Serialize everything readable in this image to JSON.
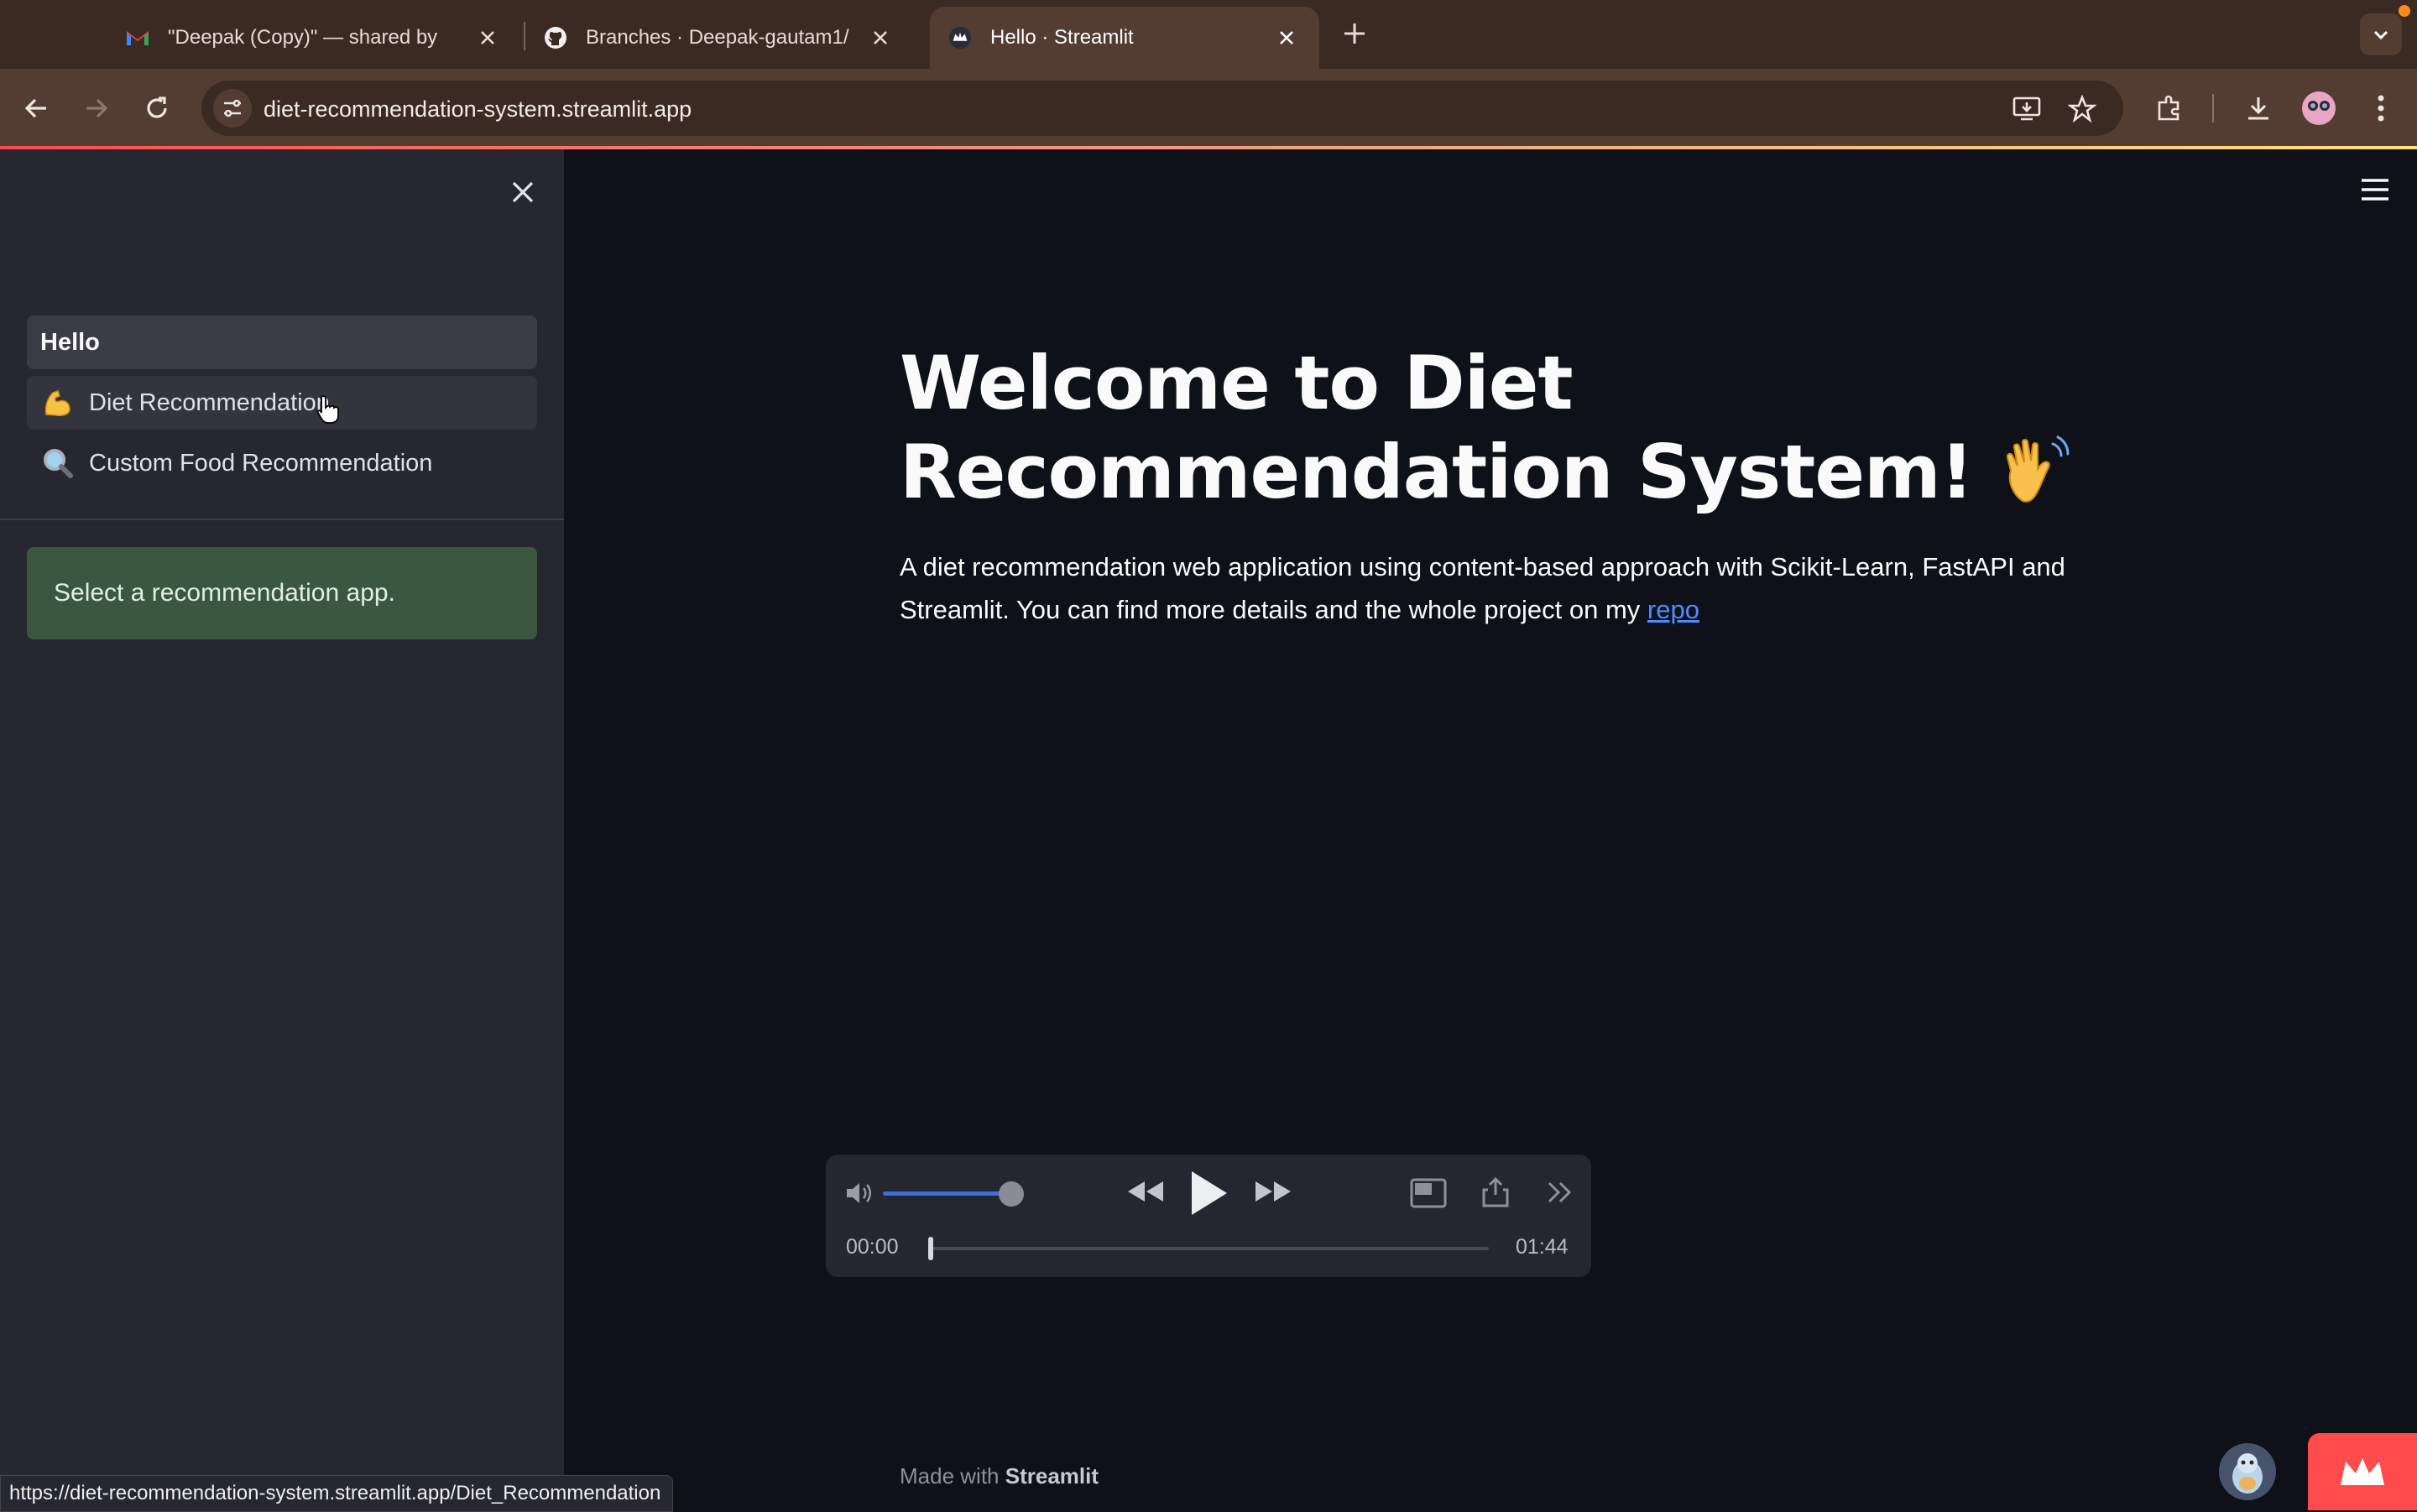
{
  "browser": {
    "tabs": [
      {
        "title": "\"Deepak (Copy)\" — shared by",
        "favicon": "gmail-icon"
      },
      {
        "title": "Branches · Deepak-gautam1/",
        "favicon": "github-icon"
      },
      {
        "title": "Hello · Streamlit",
        "favicon": "streamlit-icon",
        "active": true
      }
    ],
    "url": "diet-recommendation-system.streamlit.app",
    "status_url": "https://diet-recommendation-system.streamlit.app/Diet_Recommendation"
  },
  "sidebar": {
    "items": [
      {
        "label": "Hello",
        "icon": ""
      },
      {
        "label": "Diet Recommendation",
        "icon": "flexed-biceps-icon"
      },
      {
        "label": "Custom Food Recommendation",
        "icon": "magnifier-icon"
      }
    ],
    "info": "Select a recommendation app."
  },
  "main": {
    "title": "Welcome to Diet Recommendation System!",
    "description": "A diet recommendation web application using content-based approach with Scikit-Learn, FastAPI and Streamlit. You can find more details and the whole project on my",
    "link_text": "repo"
  },
  "player": {
    "current_time": "00:00",
    "duration": "01:44",
    "volume_level": 0.85,
    "progress": 0.0
  },
  "footer": {
    "made_with": "Made with",
    "brand": "Streamlit"
  },
  "colors": {
    "accent": "#ff4b4b",
    "link": "#4f8bff",
    "info_bg": "#3b5740",
    "sidebar_bg": "#262730",
    "app_bg": "#0e1117"
  }
}
